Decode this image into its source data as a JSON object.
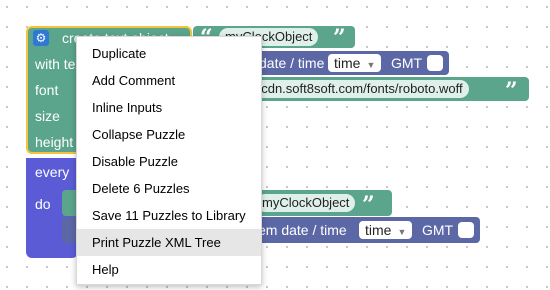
{
  "colors": {
    "object_block": "#5ba58c",
    "string_block": "#5ba58c",
    "date_block": "#5c68a6",
    "loop_block": "#5b5bd6",
    "selection_outline": "#f6c23e"
  },
  "workspace": {
    "create_block": {
      "title": "create text object",
      "rows": [
        "with text",
        "font",
        "size",
        "height"
      ],
      "name_value": "myClockObject",
      "font_url": "//cdn.soft8soft.com/fonts/roboto.woff",
      "gear_icon": "gear-icon"
    },
    "date_block_top": {
      "label": "date / time",
      "dropdown": "time",
      "gmt_label": "GMT"
    },
    "loop_block": {
      "every_label": "every",
      "do_label": "do"
    },
    "inner_block": {
      "name_value": "myClockObject",
      "system_date_label": "em date / time",
      "dropdown": "time",
      "gmt_label": "GMT"
    }
  },
  "context_menu": {
    "items": [
      "Duplicate",
      "Add Comment",
      "Inline Inputs",
      "Collapse Puzzle",
      "Disable Puzzle",
      "Delete 6 Puzzles",
      "Save 11 Puzzles to Library",
      "Print Puzzle XML Tree",
      "Help"
    ],
    "highlighted": "Print Puzzle XML Tree"
  }
}
